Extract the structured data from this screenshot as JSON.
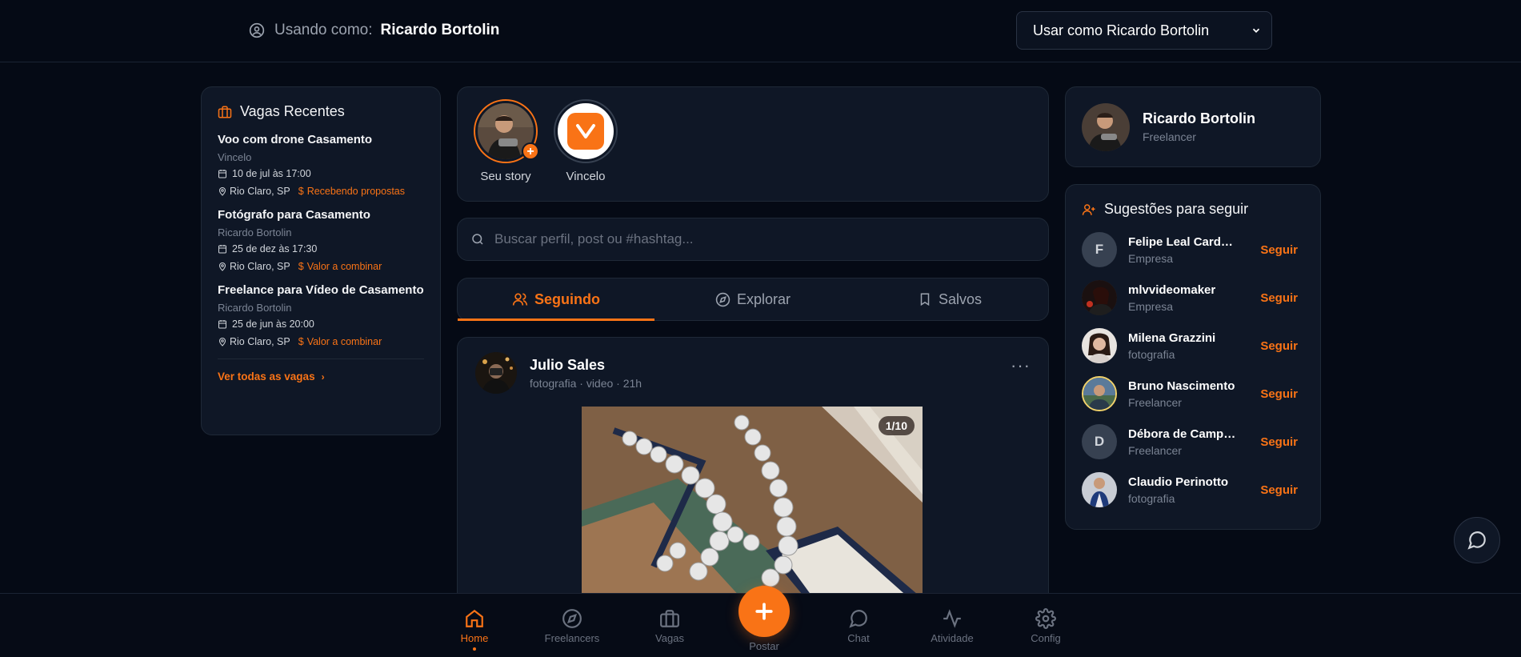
{
  "topbar": {
    "using_label": "Usando como:",
    "using_name": "Ricardo Bortolin",
    "select_value": "Usar como Ricardo Bortolin"
  },
  "jobs": {
    "title": "Vagas Recentes",
    "items": [
      {
        "title": "Voo com drone Casamento",
        "company": "Vincelo",
        "date": "10 de jul às 17:00",
        "location": "Rio Claro, SP",
        "status": "Recebendo propostas"
      },
      {
        "title": "Fotógrafo para Casamento",
        "company": "Ricardo Bortolin",
        "date": "25 de dez às 17:30",
        "location": "Rio Claro, SP",
        "status": "Valor a combinar"
      },
      {
        "title": "Freelance para Vídeo de Casamento",
        "company": "Ricardo Bortolin",
        "date": "25 de jun às 20:00",
        "location": "Rio Claro, SP",
        "status": "Valor a combinar"
      }
    ],
    "see_all": "Ver todas as vagas"
  },
  "stories": {
    "items": [
      {
        "label": "Seu story"
      },
      {
        "label": "Vincelo"
      }
    ]
  },
  "search": {
    "placeholder": "Buscar perfil, post ou #hashtag..."
  },
  "tabs": [
    {
      "label": "Seguindo",
      "icon": "users-icon",
      "active": true
    },
    {
      "label": "Explorar",
      "icon": "compass-icon",
      "active": false
    },
    {
      "label": "Salvos",
      "icon": "bookmark-icon",
      "active": false
    }
  ],
  "post": {
    "author": "Julio Sales",
    "meta": "fotografia · video · 21h",
    "counter": "1/10"
  },
  "profile": {
    "name": "Ricardo Bortolin",
    "role": "Freelancer"
  },
  "suggestions": {
    "title": "Sugestões para seguir",
    "follow_label": "Seguir",
    "items": [
      {
        "name": "Felipe Leal Cardoso",
        "role": "Empresa",
        "initial": "F"
      },
      {
        "name": "mlvvideomaker",
        "role": "Empresa",
        "initial": ""
      },
      {
        "name": "Milena Grazzini",
        "role": "fotografia",
        "initial": ""
      },
      {
        "name": "Bruno Nascimento",
        "role": "Freelancer",
        "initial": ""
      },
      {
        "name": "Débora de Campos",
        "role": "Freelancer",
        "initial": "D"
      },
      {
        "name": "Claudio Perinotto",
        "role": "fotografia",
        "initial": ""
      }
    ]
  },
  "bottomnav": {
    "home": "Home",
    "freelancers": "Freelancers",
    "vagas": "Vagas",
    "postar": "Postar",
    "chat": "Chat",
    "atividade": "Atividade",
    "config": "Config"
  },
  "colors": {
    "accent": "#f97316",
    "background": "#050a15",
    "card": "#0f1726"
  }
}
